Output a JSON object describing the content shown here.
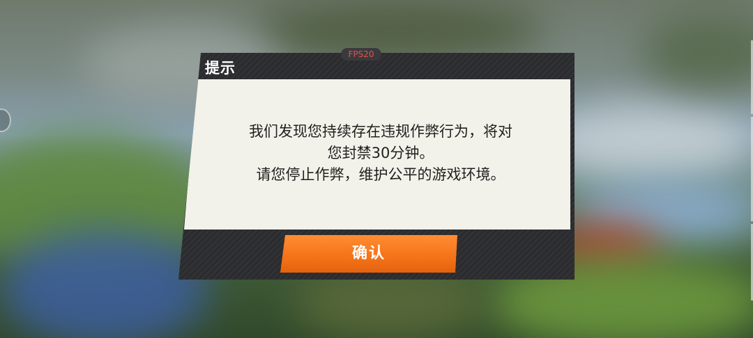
{
  "dialog": {
    "title": "提示",
    "fps_label": "FPS20",
    "message_lines": [
      "我们发现您持续存在违规作弊行为，将对",
      "您封禁30分钟。",
      "请您停止作弊，维护公平的游戏环境。"
    ],
    "confirm_label": "确认"
  },
  "colors": {
    "dialog_frame": "#2a2b2e",
    "content_background": "#f3f2ea",
    "confirm_button": "#f67419",
    "fps_text": "#e05450"
  }
}
